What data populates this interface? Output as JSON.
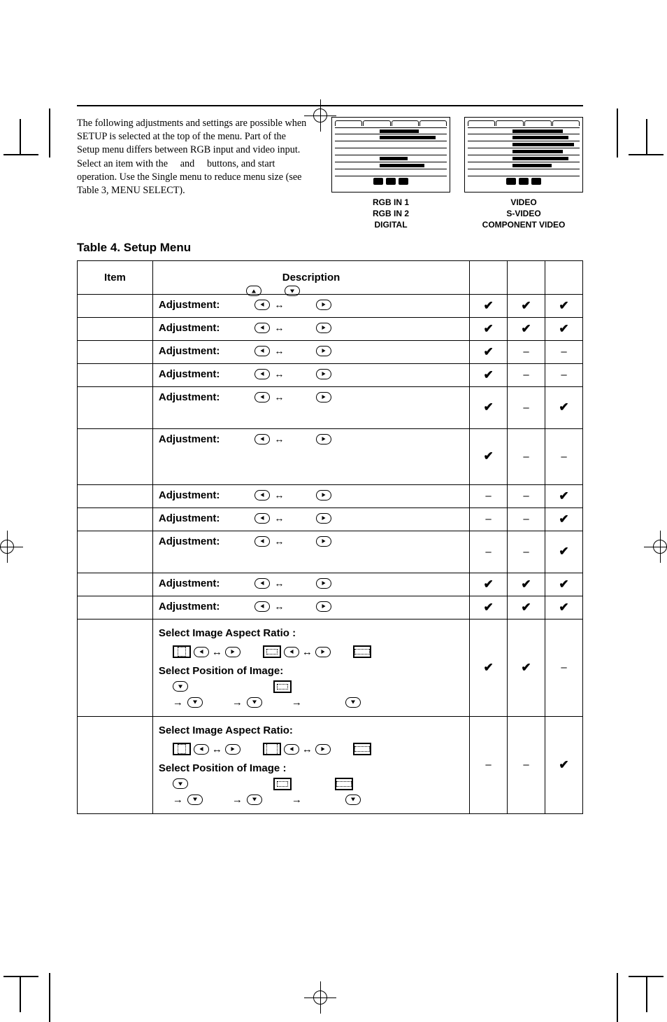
{
  "intro_text": "The following adjustments and settings are possible when SETUP is selected at the top of the menu. Part of the Setup menu differs between RGB input and video input. Select an item with the     and     buttons, and start operation. Use the Single menu to reduce menu size (see Table 3, MENU SELECT).",
  "table_title": "Table 4. Setup Menu",
  "figure_captions": {
    "a1": "RGB IN 1",
    "a2": "RGB IN 2",
    "a3": "DIGITAL",
    "b1": "VIDEO",
    "b2": "S-VIDEO",
    "b3": "COMPONENT VIDEO"
  },
  "columns": {
    "item": "Item",
    "desc": "Description"
  },
  "labels": {
    "adjustment": "Adjustment:",
    "select_aspect": "Select Image Aspect Ratio :",
    "select_aspect2": "Select Image Aspect Ratio:",
    "select_position": "Select Position of Image:",
    "select_position2": "Select Position of Image :"
  },
  "glyphs": {
    "check": "✔",
    "dash": "–",
    "lrarr": "↔",
    "rarr": "→"
  },
  "rows": [
    {
      "type": "adj",
      "c": [
        "check",
        "check",
        "check"
      ]
    },
    {
      "type": "adj",
      "c": [
        "check",
        "check",
        "check"
      ]
    },
    {
      "type": "adj",
      "c": [
        "check",
        "dash",
        "dash"
      ]
    },
    {
      "type": "adj",
      "c": [
        "check",
        "dash",
        "dash"
      ]
    },
    {
      "type": "adj",
      "height": "tall",
      "c": [
        "check",
        "dash",
        "check"
      ]
    },
    {
      "type": "adj",
      "height": "taller",
      "c": [
        "check",
        "dash",
        "dash"
      ]
    },
    {
      "type": "adj",
      "c": [
        "dash",
        "dash",
        "check"
      ]
    },
    {
      "type": "adj",
      "c": [
        "dash",
        "dash",
        "check"
      ]
    },
    {
      "type": "adj",
      "height": "tall",
      "c": [
        "dash",
        "dash",
        "check"
      ]
    },
    {
      "type": "adj",
      "c": [
        "check",
        "check",
        "check"
      ]
    },
    {
      "type": "adj",
      "c": [
        "check",
        "check",
        "check"
      ]
    },
    {
      "type": "aspect_a",
      "c": [
        "check",
        "check",
        "dash"
      ]
    },
    {
      "type": "aspect_b",
      "c": [
        "dash",
        "dash",
        "check"
      ]
    }
  ]
}
